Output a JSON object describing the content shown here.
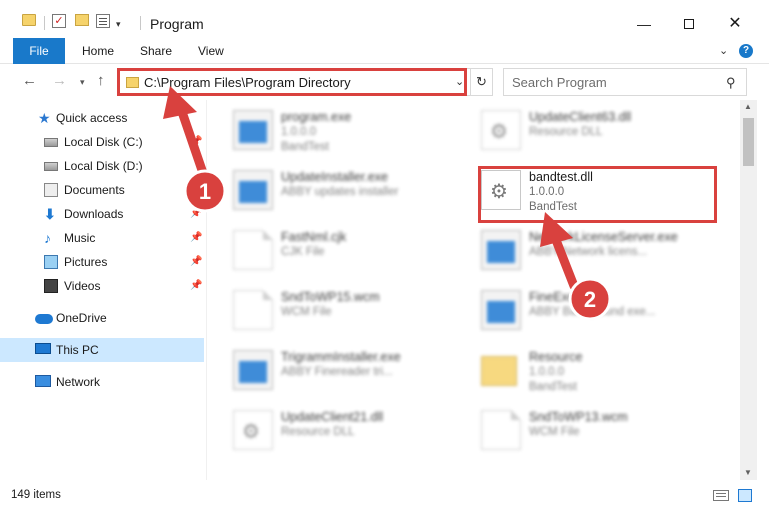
{
  "window": {
    "title": "Program"
  },
  "titlebar": {
    "minimize": "—",
    "close": "✕"
  },
  "ribbon": {
    "tabs": [
      {
        "label": "File"
      },
      {
        "label": "Home"
      },
      {
        "label": "Share"
      },
      {
        "label": "View"
      }
    ],
    "help": "?"
  },
  "nav": {
    "back": "←",
    "forward": "→",
    "recent": "▾",
    "up": "↑",
    "address": "C:\\Program Files\\Program Directory",
    "address_dropdown": "⌄",
    "refresh": "↻",
    "search_placeholder": "Search Program",
    "search_icon": "⚲"
  },
  "sidebar": {
    "items": [
      {
        "label": "Quick access",
        "icon": "star-icon"
      },
      {
        "label": "Local Disk (C:)",
        "icon": "disk-icon",
        "pinned": true
      },
      {
        "label": "Local Disk (D:)",
        "icon": "disk-icon"
      },
      {
        "label": "Documents",
        "icon": "documents-icon",
        "pinned": true
      },
      {
        "label": "Downloads",
        "icon": "downloads-icon",
        "pinned": true
      },
      {
        "label": "Music",
        "icon": "music-icon",
        "pinned": true
      },
      {
        "label": "Pictures",
        "icon": "pictures-icon",
        "pinned": true
      },
      {
        "label": "Videos",
        "icon": "videos-icon",
        "pinned": true
      },
      {
        "label": "OneDrive",
        "icon": "onedrive-icon"
      },
      {
        "label": "This PC",
        "icon": "pc-icon",
        "selected": true
      },
      {
        "label": "Network",
        "icon": "network-icon"
      }
    ]
  },
  "files": [
    {
      "name": "program.exe",
      "line2": "1.0.0.0",
      "line3": "BandTest",
      "kind": "app"
    },
    {
      "name": "UpdateClient63.dll",
      "line2": "Resource DLL",
      "line3": "",
      "kind": "gear"
    },
    {
      "name": "UpdateInstaller.exe",
      "line2": "ABBY updates installer",
      "line3": "",
      "kind": "app"
    },
    {
      "name": "bandtest.dll",
      "line2": "1.0.0.0",
      "line3": "BandTest",
      "kind": "gear",
      "highlighted": true
    },
    {
      "name": "FastNml.cjk",
      "line2": "CJK File",
      "line3": "",
      "kind": "doc"
    },
    {
      "name": "NetworkLicenseServer.exe",
      "line2": "ABBY Network licens...",
      "line3": "",
      "kind": "app"
    },
    {
      "name": "SndToWP15.wcm",
      "line2": "WCM File",
      "line3": "",
      "kind": "doc"
    },
    {
      "name": "FineExecutive",
      "line2": "ABBY Background exe...",
      "line3": "",
      "kind": "app"
    },
    {
      "name": "TrigrammInstaller.exe",
      "line2": "ABBY Finereader tri...",
      "line3": "",
      "kind": "app"
    },
    {
      "name": "Resource",
      "line2": "1.0.0.0",
      "line3": "BandTest",
      "kind": "folder"
    },
    {
      "name": "UpdateClient21.dll",
      "line2": "Resource DLL",
      "line3": "",
      "kind": "gear"
    },
    {
      "name": "SndToWP13.wcm",
      "line2": "WCM File",
      "line3": "",
      "kind": "doc"
    }
  ],
  "status": {
    "count": "149 items"
  },
  "annotations": [
    {
      "label": "1"
    },
    {
      "label": "2"
    }
  ],
  "colors": {
    "accent": "#1979ca",
    "highlight": "#d9413e",
    "selected": "#cce8ff"
  }
}
